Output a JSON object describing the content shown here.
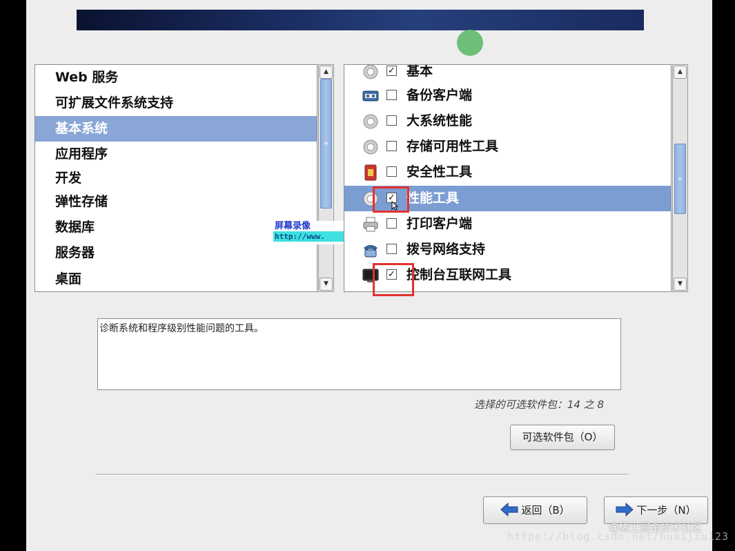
{
  "groups": {
    "items": [
      {
        "label": "Web 服务",
        "selected": false
      },
      {
        "label": "可扩展文件系统支持",
        "selected": false
      },
      {
        "label": "基本系统",
        "selected": true
      },
      {
        "label": "应用程序",
        "selected": false
      },
      {
        "label": "开发",
        "selected": false
      },
      {
        "label": "弹性存储",
        "selected": false
      },
      {
        "label": "数据库",
        "selected": false
      },
      {
        "label": "服务器",
        "selected": false
      },
      {
        "label": "桌面",
        "selected": false
      }
    ]
  },
  "packages": {
    "items": [
      {
        "label": "基本",
        "checked": true,
        "icon": "gear-icon"
      },
      {
        "label": "备份客户端",
        "checked": false,
        "icon": "tape-backup-icon"
      },
      {
        "label": "大系统性能",
        "checked": false,
        "icon": "gear-icon"
      },
      {
        "label": "存储可用性工具",
        "checked": false,
        "icon": "gear-icon"
      },
      {
        "label": "安全性工具",
        "checked": false,
        "icon": "security-icon"
      },
      {
        "label": "性能工具",
        "checked": true,
        "icon": "gear-icon",
        "selected": true
      },
      {
        "label": "打印客户端",
        "checked": false,
        "icon": "printer-icon"
      },
      {
        "label": "拨号网络支持",
        "checked": false,
        "icon": "phone-icon"
      },
      {
        "label": "控制台互联网工具",
        "checked": true,
        "icon": "terminal-icon"
      }
    ]
  },
  "watermark": {
    "line1": "屏幕录像",
    "line2": "http://www."
  },
  "description": "诊断系统和程序级别性能问题的工具。",
  "selection_count": "选择的可选软件包：14 之 8",
  "buttons": {
    "optional": "可选软件包（O）",
    "back": "返回（B）",
    "next": "下一步（N）"
  },
  "credit": {
    "line1": "@稀土掘金技术社区",
    "line2": "https://blog.csdn.net/huaijiu123"
  },
  "colors": {
    "selection": "#8aa6d6",
    "highlight_box": "#e3322e"
  }
}
